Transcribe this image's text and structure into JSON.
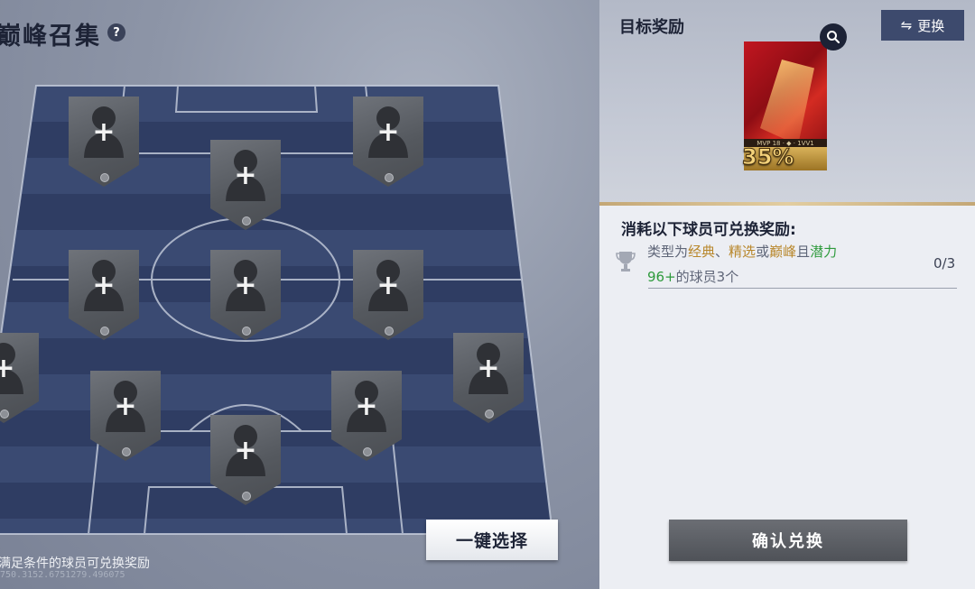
{
  "page": {
    "title": "巅峰召集",
    "help_icon": "?",
    "bottom_hint": "满足条件的球员可兑换奖励",
    "bottom_coords": "750.3152.6751279.496075"
  },
  "formation": {
    "slots": [
      {
        "plus": "+"
      },
      {
        "plus": "+"
      },
      {
        "plus": "+"
      },
      {
        "plus": "+"
      },
      {
        "plus": "+"
      },
      {
        "plus": "+"
      },
      {
        "plus": "+"
      },
      {
        "plus": "+"
      },
      {
        "plus": "+"
      },
      {
        "plus": "+"
      },
      {
        "plus": "+"
      }
    ],
    "auto_select_label": "一键选择"
  },
  "reward": {
    "title": "目标奖励",
    "swap_icon": "⇋",
    "swap_label": "更换",
    "pack_percent": "35%",
    "pack_strip_text": "MVP 18 · ◆ · 1VV1",
    "magnify_icon": "search-icon"
  },
  "requirement": {
    "heading": "消耗以下球员可兑换奖励:",
    "text_prefix": "类型为",
    "type_classic": "经典",
    "sep1": "、",
    "type_select": "精选",
    "sep2": "或",
    "type_peak": "巅峰",
    "sep3": "且",
    "potential_label": "潜力",
    "potential_value": "96+",
    "text_suffix": "的球员3个",
    "progress": "0/3"
  },
  "actions": {
    "confirm_label": "确认兑换"
  },
  "colors": {
    "accent_dark": "#1d2336",
    "gold": "#b8872b",
    "green": "#2e9a3c",
    "swap_bg": "#3d4a6d"
  }
}
